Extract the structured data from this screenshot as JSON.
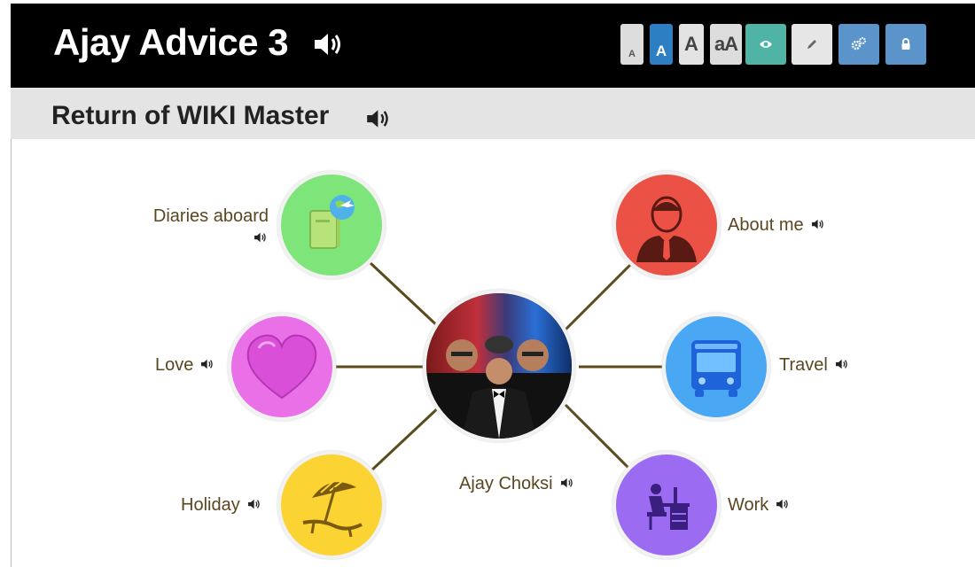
{
  "header": {
    "title": "Ajay Advice 3",
    "toolbar": {
      "font_small": "A",
      "font_normal": "A",
      "font_large": "A",
      "font_toggle": "aA"
    }
  },
  "page": {
    "title": "Return of WIKI Master"
  },
  "mindmap": {
    "center_label": "Ajay Choksi",
    "nodes": [
      {
        "label": "Diaries aboard",
        "color": "#7ee57a"
      },
      {
        "label": "About me",
        "color": "#ec5145"
      },
      {
        "label": "Love",
        "color": "#e970e6"
      },
      {
        "label": "Travel",
        "color": "#4aa7f4"
      },
      {
        "label": "Holiday",
        "color": "#fbd332"
      },
      {
        "label": "Work",
        "color": "#9b6cf1"
      }
    ],
    "connector_color": "#5b4a1c"
  },
  "icons": {
    "speaker": "speaker-icon",
    "eye": "eye-icon",
    "pencil": "pencil-icon",
    "gears": "gears-icon",
    "lock": "lock-icon"
  }
}
